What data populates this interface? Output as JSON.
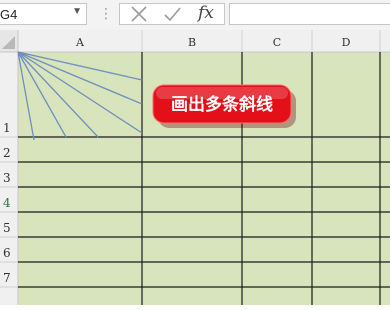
{
  "formula_bar": {
    "namebox_value": "G4",
    "namebox_arrow": "▼",
    "dots": "⋮",
    "cancel_icon": "cancel-x-icon",
    "confirm_icon": "checkmark-icon",
    "fx_label": "fx",
    "formula_value": ""
  },
  "sheet": {
    "columns": [
      "A",
      "B",
      "C",
      "D"
    ],
    "rows": [
      "1",
      "2",
      "3",
      "4",
      "5",
      "6",
      "7"
    ],
    "selected_row": "4",
    "colors": {
      "cell_fill": "#d8e4bc",
      "header_bg": "#f0f0f0",
      "selected_header_text": "#217346",
      "diagonal_line": "#6f8fc0",
      "gridline": "#1a1a1a"
    }
  },
  "callout": {
    "text": "画出多条斜线",
    "fill": "#e3101a",
    "text_color": "#ffffff"
  }
}
